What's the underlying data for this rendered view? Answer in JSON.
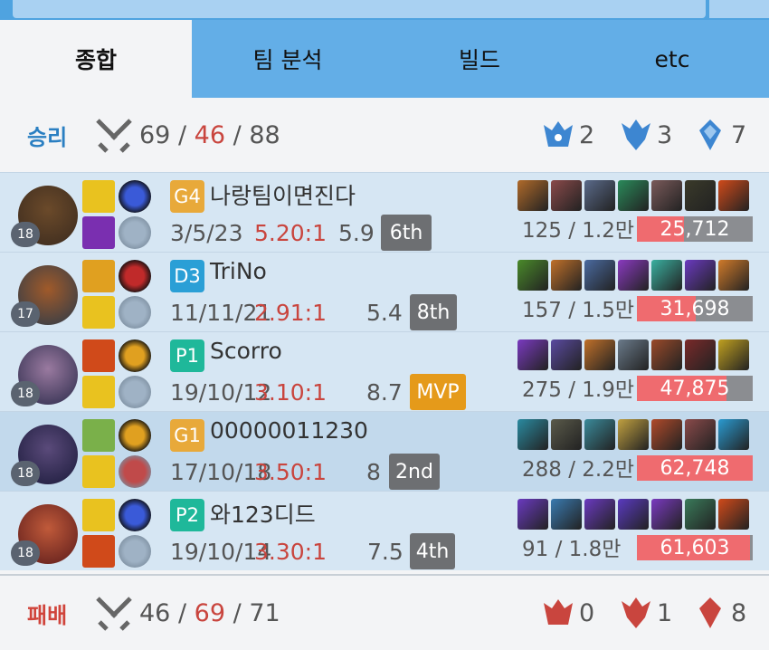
{
  "tabs": [
    {
      "label": "종합",
      "active": true
    },
    {
      "label": "팀 분석",
      "active": false
    },
    {
      "label": "빌드",
      "active": false
    },
    {
      "label": "etc",
      "active": false
    }
  ],
  "win_team": {
    "result": "승리",
    "color": "#2a7fc2",
    "kills": "69",
    "deaths": "46",
    "assists": "88",
    "sep": "/",
    "baron": "2",
    "dragon": "3",
    "tower": "7"
  },
  "lose_team": {
    "result": "패배",
    "color": "#d0443b",
    "kills": "46",
    "deaths": "69",
    "assists": "71",
    "sep": "/",
    "baron": "0",
    "dragon": "1",
    "tower": "8"
  },
  "players": [
    {
      "level": "18",
      "tier": "G4",
      "tier_color": "#e8a93a",
      "name": "나랑팀이면진다",
      "kda": "3/5/23",
      "ratio": "5.20:1",
      "score": "5.9",
      "badge": "6th",
      "badge_color": "#6d6f72",
      "cs": "125 / 1.2만",
      "damage": "25,712",
      "damage_fraction": 0.41,
      "avatar_colors": [
        "#3a2a1e",
        "#6b4a2a"
      ],
      "spells": [
        "#e9c21f",
        "#7a2fb0"
      ],
      "runes": [
        "#3a5ad8",
        "#9fb2c5"
      ],
      "items": [
        "#b06a2a",
        "#8a4a4a",
        "#5a6a8a",
        "#2a8a5a",
        "#7a5a5a",
        "#3a3a2a",
        "#d04a1a"
      ]
    },
    {
      "level": "17",
      "tier": "D3",
      "tier_color": "#2a9fd6",
      "name": "TriNo",
      "kda": "11/11/21",
      "ratio": "2.91:1",
      "score": "5.4",
      "badge": "8th",
      "badge_color": "#6d6f72",
      "cs": "157 / 1.5만",
      "damage": "31,698",
      "damage_fraction": 0.51,
      "avatar_colors": [
        "#2a3a4a",
        "#a05a2a"
      ],
      "spells": [
        "#e0a020",
        "#e9c21f"
      ],
      "runes": [
        "#c02a2a",
        "#9fb2c5"
      ],
      "items": [
        "#4a8a2a",
        "#c0702a",
        "#4a6aa0",
        "#8a3ac0",
        "#3ab0a0",
        "#6a3ac0",
        "#d07a2a"
      ]
    },
    {
      "level": "18",
      "tier": "P1",
      "tier_color": "#1fb89a",
      "name": "Scorro",
      "kda": "19/10/12",
      "ratio": "3.10:1",
      "score": "8.7",
      "badge": "MVP",
      "badge_color": "#e59a1a",
      "cs": "275 / 1.9만",
      "damage": "47,875",
      "damage_fraction": 0.77,
      "avatar_colors": [
        "#2a2a4a",
        "#9a7aa0"
      ],
      "spells": [
        "#d04a1a",
        "#e9c21f"
      ],
      "runes": [
        "#e0a020",
        "#9fb2c5"
      ],
      "items": [
        "#7a3ac0",
        "#5a4aa0",
        "#c0702a",
        "#6a7a8a",
        "#9a4a2a",
        "#7a2a2a",
        "#c0a020"
      ]
    },
    {
      "level": "18",
      "tier": "G1",
      "tier_color": "#e8a93a",
      "name": "00000011230",
      "kda": "17/10/18",
      "ratio": "3.50:1",
      "score": "8",
      "badge": "2nd",
      "badge_color": "#6d6f72",
      "cs": "288 / 2.2만",
      "damage": "62,748",
      "damage_fraction": 1.0,
      "avatar_colors": [
        "#1a1a3a",
        "#5a4a7a"
      ],
      "spells": [
        "#7ab04a",
        "#e9c21f"
      ],
      "runes": [
        "#e0a020",
        "#c04a4a"
      ],
      "items": [
        "#2a8aa0",
        "#5a5a4a",
        "#3a8a9a",
        "#c0a040",
        "#b04a2a",
        "#8a4a4a",
        "#2a9ad0"
      ]
    },
    {
      "level": "18",
      "tier": "P2",
      "tier_color": "#1fb89a",
      "name": "와123디드",
      "kda": "19/10/14",
      "ratio": "3.30:1",
      "score": "7.5",
      "badge": "4th",
      "badge_color": "#6d6f72",
      "cs": "91 / 1.8만",
      "damage": "61,603",
      "damage_fraction": 0.98,
      "avatar_colors": [
        "#5a1a1a",
        "#c05a3a"
      ],
      "spells": [
        "#e9c21f",
        "#d04a1a"
      ],
      "runes": [
        "#3a5ad8",
        "#9fb2c5"
      ],
      "items": [
        "#6a3ac0",
        "#3a7ab0",
        "#6a3ac0",
        "#5a3ac0",
        "#7a3ac0",
        "#3a7a5a",
        "#d04a1a"
      ]
    }
  ]
}
